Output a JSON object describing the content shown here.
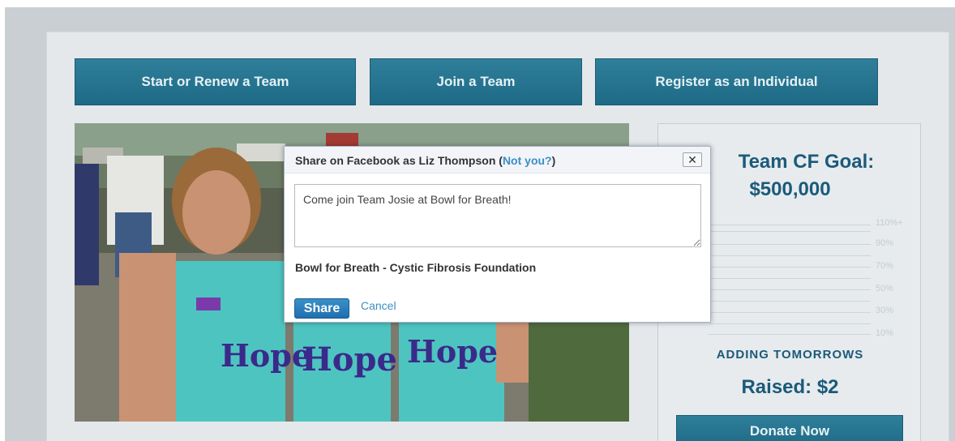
{
  "buttons": {
    "start_team": "Start or Renew a Team",
    "join_team": "Join a Team",
    "register_individual": "Register as an Individual"
  },
  "goal": {
    "title": "Team CF Goal:",
    "amount": "$500,000",
    "thermometer_labels": [
      "110%+",
      "90%",
      "70%",
      "50%",
      "30%",
      "10%"
    ],
    "adding_text": "ADDING TOMORROWS",
    "raised": "Raised: $2",
    "donate_label": "Donate Now"
  },
  "photo": {
    "shirt_text": [
      "Hope",
      "Hope",
      "Hope"
    ]
  },
  "share_dialog": {
    "title_prefix": "Share on Facebook as Liz Thompson (",
    "not_you": "Not you?",
    "title_suffix": ")",
    "close_symbol": "✕",
    "message": "Come join Team Josie at Bowl for Breath!",
    "link_title": "Bowl for Breath - Cystic Fibrosis Foundation",
    "share_label": "Share",
    "cancel_label": "Cancel"
  },
  "colors": {
    "button_teal": "#1e6a86",
    "goal_text": "#1b5a7a",
    "facebook_blue": "#3b8fc4"
  }
}
